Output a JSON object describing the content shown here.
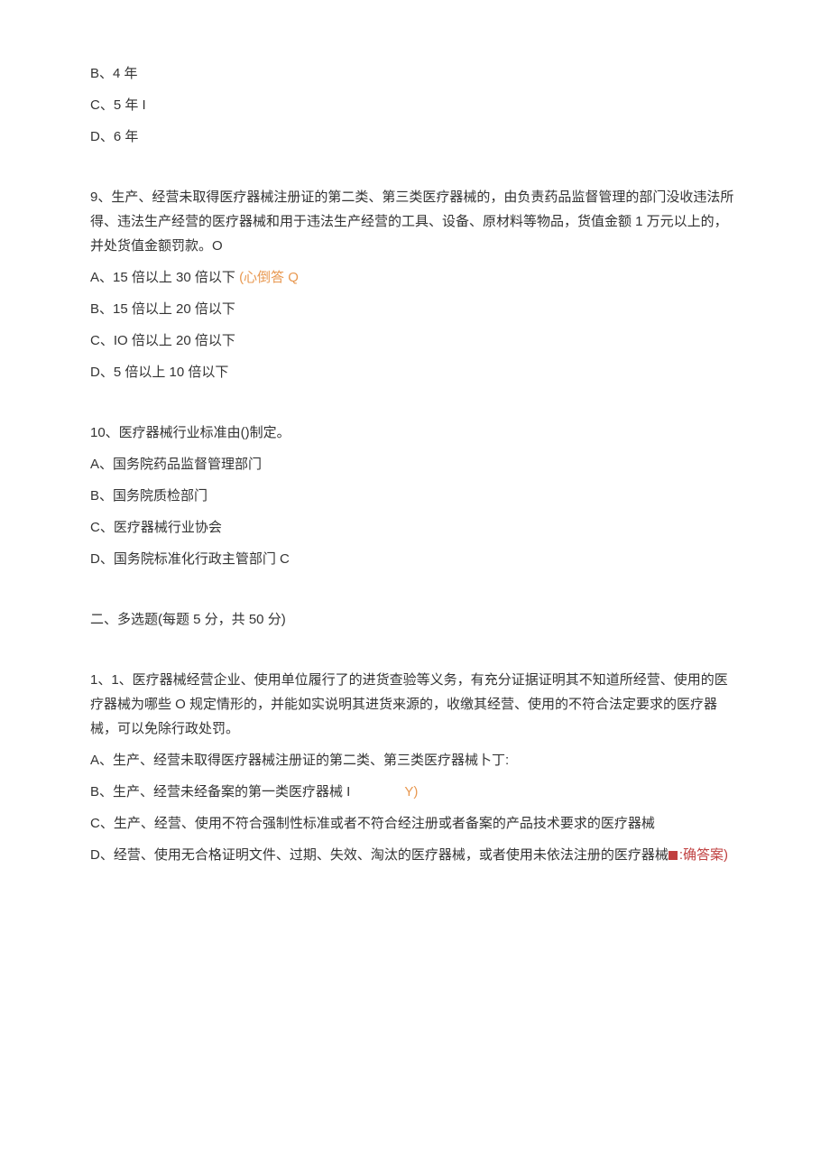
{
  "q8": {
    "opts": {
      "b": "B、4 年",
      "c": "C、5 年 I",
      "d": "D、6 年"
    }
  },
  "q9": {
    "stem": "9、生产、经营未取得医疗器械注册证的第二类、第三类医疗器械的，由负责药品监督管理的部门没收违法所得、违法生产经营的医疗器械和用于违法生产经营的工具、设备、原材料等物品，货值金额 1 万元以上的，并处货值金额罚款。O",
    "opts": {
      "a_text": "A、15 倍以上 30 倍以下",
      "a_anno": "(心倒答 Q",
      "b": "B、15 倍以上 20 倍以下",
      "c": "C、IO 倍以上 20 倍以下",
      "d": "D、5 倍以上 10 倍以下"
    }
  },
  "q10": {
    "stem": "10、医疗器械行业标准由()制定。",
    "opts": {
      "a": "A、国务院药品监督管理部门",
      "b": "B、国务院质检部门",
      "c": "C、医疗器械行业协会",
      "d": "D、国务院标准化行政主管部门 C"
    }
  },
  "section2": {
    "header": "二、多选题(每题 5 分，共 50 分)"
  },
  "s2q1": {
    "stem": "1、1、医疗器械经营企业、使用单位履行了的进货查验等义务，有充分证据证明其不知道所经营、使用的医疗器械为哪些 O 规定情形的，并能如实说明其进货来源的，收缴其经营、使用的不符合法定要求的医疗器械，可以免除行政处罚。",
    "opts": {
      "a": "A、生产、经营未取得医疗器械注册证的第二类、第三类医疗器械卜丁:",
      "b_text": "B、生产、经营未经备案的第一类医疗器械 I",
      "b_anno": "Y)",
      "c": "C、生产、经营、使用不符合强制性标准或者不符合经注册或者备案的产品技术要求的医疗器械",
      "d_text": "D、经营、使用无合格证明文件、过期、失效、淘汰的医疗器械，或者使用未依法注册的医疗器械",
      "d_anno": ":确答案)"
    }
  }
}
